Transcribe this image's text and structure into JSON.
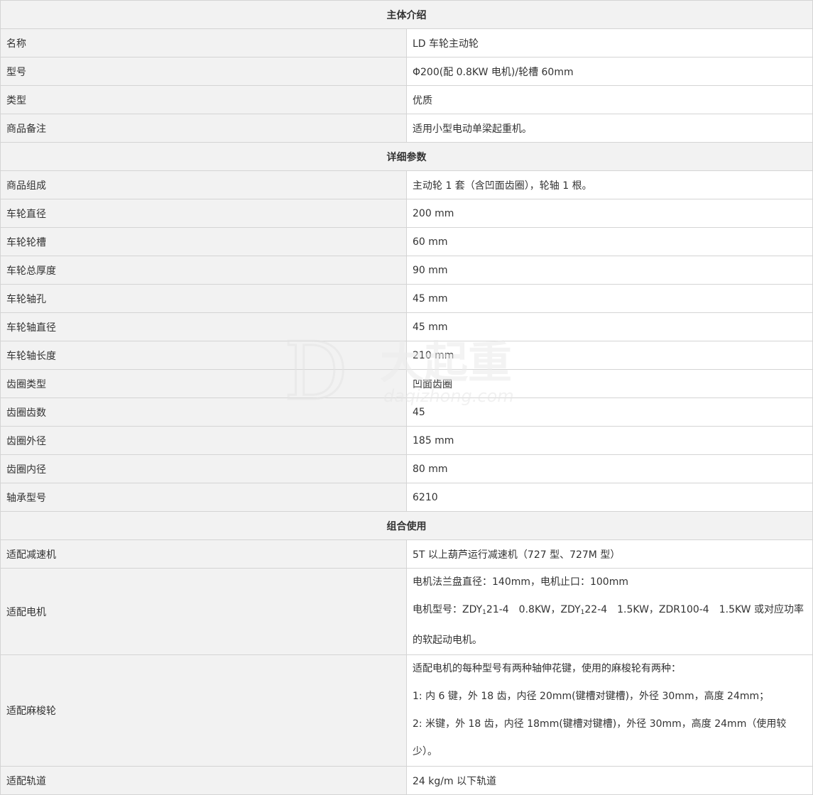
{
  "section1": {
    "title": "主体介绍",
    "rows": [
      {
        "label": "名称",
        "value": "LD 车轮主动轮"
      },
      {
        "label": "型号",
        "value": "Φ200(配 0.8KW 电机)/轮槽 60mm"
      },
      {
        "label": "类型",
        "value": "优质"
      },
      {
        "label": "商品备注",
        "value": "适用小型电动单梁起重机。"
      }
    ]
  },
  "section2": {
    "title": "详细参数",
    "rows": [
      {
        "label": "商品组成",
        "value": "主动轮 1 套（含凹面齿圈），轮轴 1 根。"
      },
      {
        "label": "车轮直径",
        "value": "200 mm"
      },
      {
        "label": "车轮轮槽",
        "value": "60 mm"
      },
      {
        "label": "车轮总厚度",
        "value": "90 mm"
      },
      {
        "label": "车轮轴孔",
        "value": "45 mm"
      },
      {
        "label": "车轮轴直径",
        "value": "45 mm"
      },
      {
        "label": "车轮轴长度",
        "value": "210 mm"
      },
      {
        "label": "齿圈类型",
        "value": "凹面齿圈"
      },
      {
        "label": "齿圈齿数",
        "value": "45"
      },
      {
        "label": "齿圈外径",
        "value": "185 mm"
      },
      {
        "label": "齿圈内径",
        "value": "80 mm"
      },
      {
        "label": "轴承型号",
        "value": "6210"
      }
    ]
  },
  "section3": {
    "title": "组合使用",
    "reducer": {
      "label": "适配减速机",
      "value": "5T 以上葫芦运行减速机（727 型、727M 型）"
    },
    "motor": {
      "label": "适配电机",
      "line1": "电机法兰盘直径：140mm，电机止口：100mm",
      "line2_a": "电机型号：ZDY",
      "sub1": "1",
      "line2_b": "21-4　0.8KW，ZDY",
      "sub2": "1",
      "line2_c": "22-4　1.5KW，ZDR100-4　1.5KW 或对应功率的软起动电机。"
    },
    "coupling": {
      "label": "适配麻梭轮",
      "line1": "适配电机的每种型号有两种轴伸花键，使用的麻梭轮有两种：",
      "line2": "1:  内 6 键，外 18 齿，内径 20mm(键槽对键槽)，外径 30mm，高度 24mm；",
      "line3": "2:  米键，外 18 齿，内径 18mm(键槽对键槽)，外径 30mm，高度 24mm（使用较少）。"
    },
    "rail": {
      "label": "适配轨道",
      "value": "24 kg/m 以下轨道"
    }
  },
  "watermark": {
    "chars": "大起重",
    "domain": "daqizhong.com",
    "letter": "D"
  }
}
